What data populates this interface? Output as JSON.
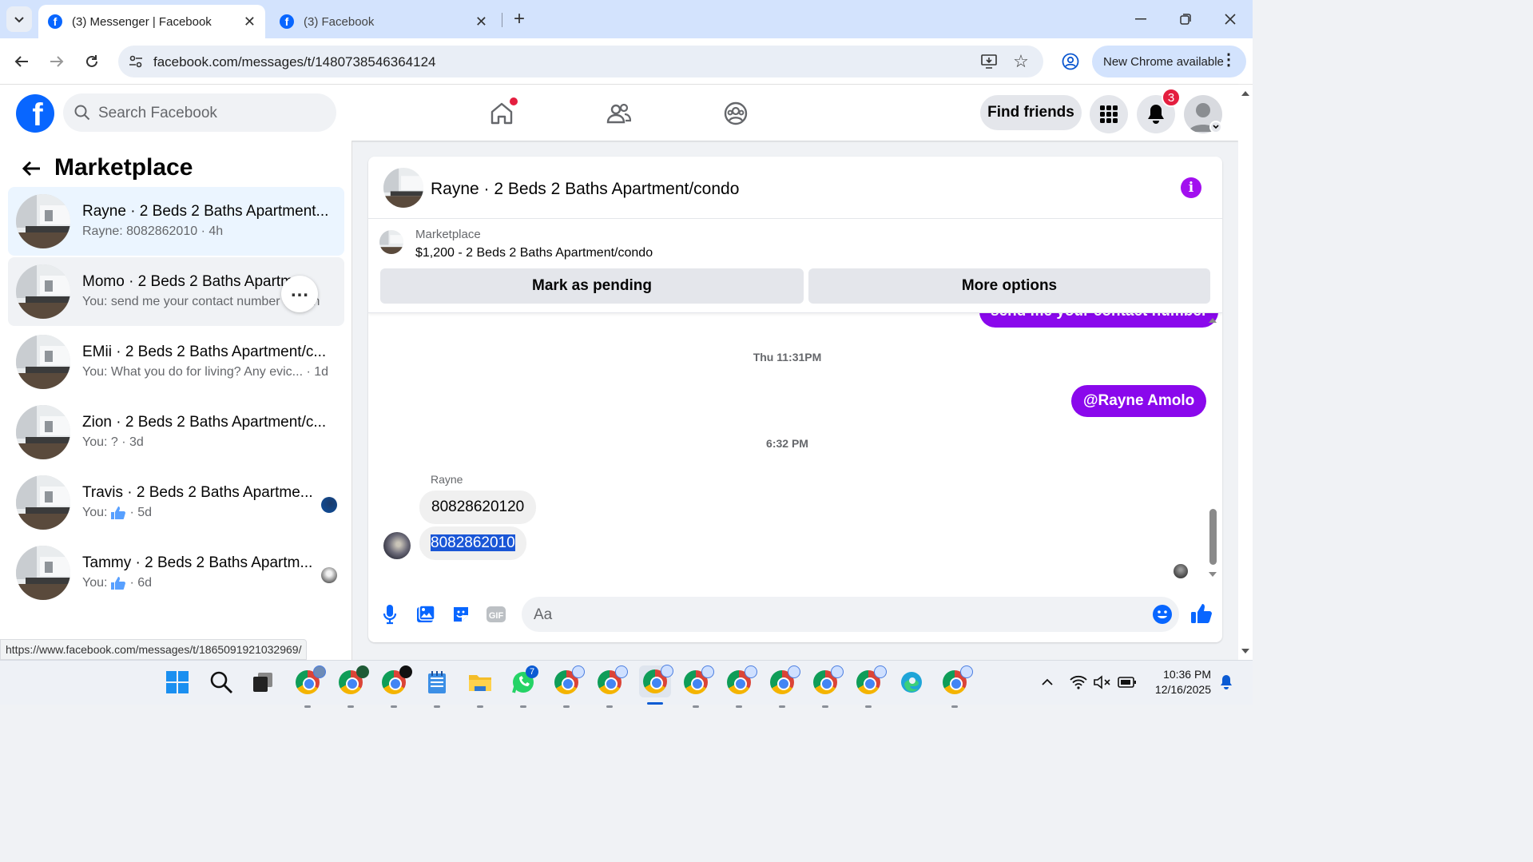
{
  "browser": {
    "tabs": [
      {
        "title": "(3) Messenger | Facebook",
        "active": true
      },
      {
        "title": "(3) Facebook",
        "active": false
      }
    ],
    "url": "facebook.com/messages/t/1480738546364124",
    "new_chrome_label": "New Chrome available",
    "status_url": "https://www.facebook.com/messages/t/1865091921032969/"
  },
  "header": {
    "logo": "f",
    "search_placeholder": "Search Facebook",
    "find_friends_label": "Find friends",
    "notification_count": "3"
  },
  "sidebar": {
    "title": "Marketplace",
    "conversations": [
      {
        "name": "Rayne · 2 Beds 2 Baths Apartment...",
        "preview": "Rayne: 8082862010 · 4h",
        "selected": true
      },
      {
        "name": "Momo · 2 Beds 2 Baths Apartm...",
        "preview": "You: send me your contact number ... · 2h",
        "hovered": true
      },
      {
        "name": "EMii · 2 Beds 2 Baths Apartment/c...",
        "preview": "You: What you do for living? Any evic... · 1d"
      },
      {
        "name": "Zion · 2 Beds 2 Baths Apartment/c...",
        "preview": "You: ? · 3d"
      },
      {
        "name": "Travis · 2 Beds 2 Baths Apartme...",
        "preview_prefix": "You:",
        "preview_suffix": "· 5d"
      },
      {
        "name": "Tammy · 2 Beds 2 Baths Apartm...",
        "preview_prefix": "You:",
        "preview_suffix": "· 6d"
      }
    ]
  },
  "chat": {
    "title": "Rayne · 2 Beds 2 Baths Apartment/condo",
    "listing_source": "Marketplace",
    "listing_title": "$1,200 - 2 Beds 2 Baths Apartment/condo",
    "mark_pending_label": "Mark as pending",
    "more_options_label": "More options",
    "messages": {
      "partial_out": "send me your contact number",
      "stamp1": "Thu 11:31PM",
      "out1": "@Rayne Amolo",
      "stamp2": "6:32 PM",
      "sender": "Rayne",
      "in1": "80828620120",
      "in2": "8082862010"
    },
    "composer_placeholder": "Aa"
  },
  "taskbar": {
    "time": "10:36 PM",
    "date": "12/16/2025",
    "whatsapp_badge": "7"
  },
  "colors": {
    "facebook_blue": "#0866ff",
    "messenger_purple": "#8a08ec",
    "badge_red": "#e41e3f"
  }
}
